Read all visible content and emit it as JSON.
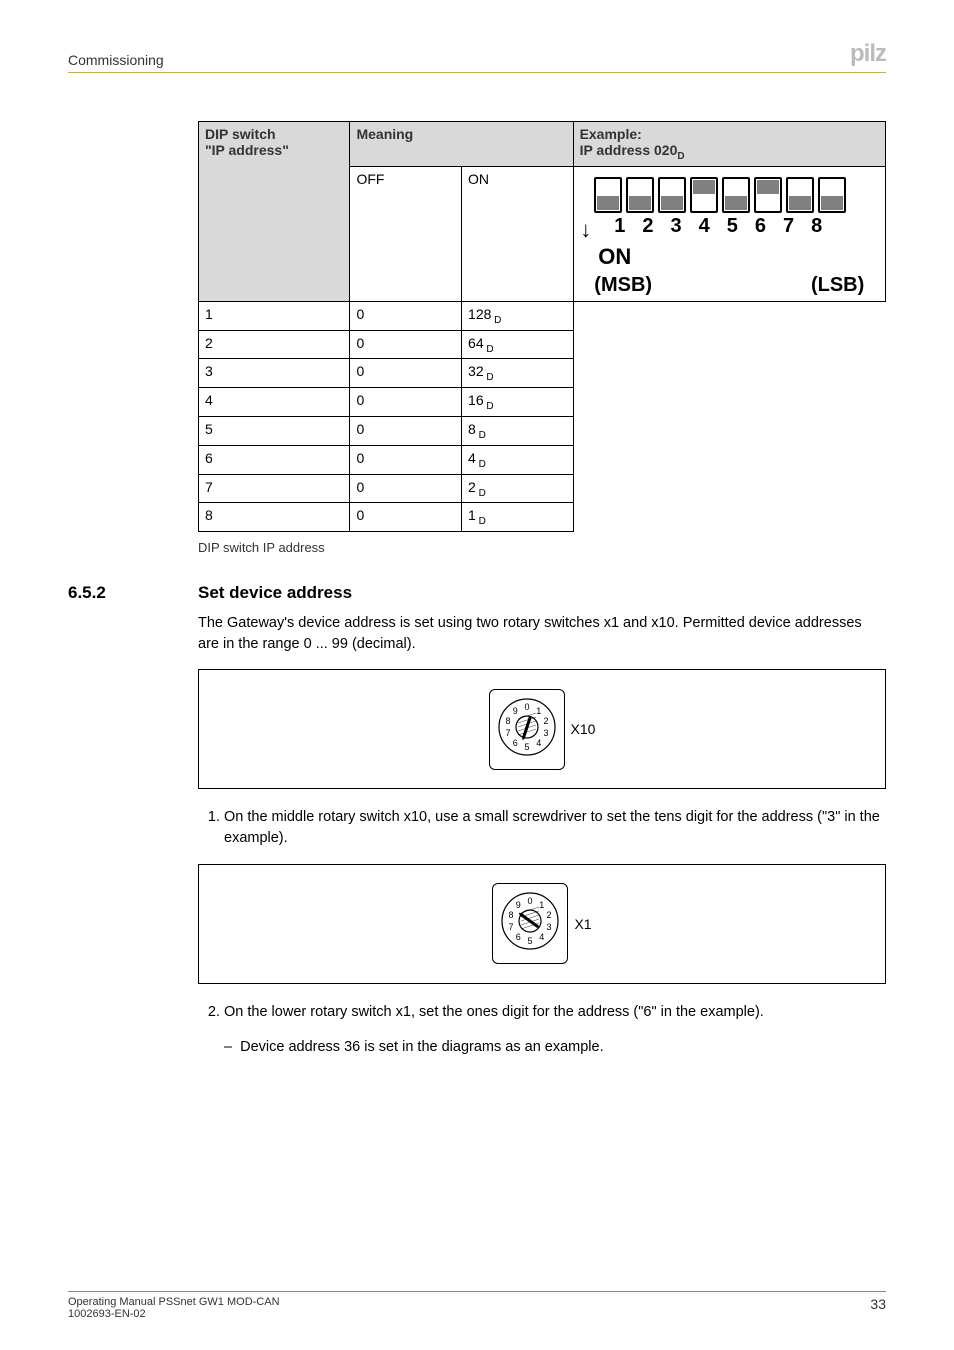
{
  "header": {
    "title": "Commissioning",
    "logo": "pilz"
  },
  "table": {
    "head": {
      "dip_switch": "DIP switch",
      "ip_address_label": "\"IP address\"",
      "meaning": "Meaning",
      "example": "Example:",
      "example_sub_prefix": "IP address 020",
      "example_sub_suffix": "D"
    },
    "meaning_cols": {
      "off": "OFF",
      "on": "ON"
    },
    "rows": [
      {
        "switch": "1",
        "off": "0",
        "on_val": "128",
        "on_sub": "D"
      },
      {
        "switch": "2",
        "off": "0",
        "on_val": "64",
        "on_sub": "D"
      },
      {
        "switch": "3",
        "off": "0",
        "on_val": "32",
        "on_sub": "D"
      },
      {
        "switch": "4",
        "off": "0",
        "on_val": "16",
        "on_sub": "D"
      },
      {
        "switch": "5",
        "off": "0",
        "on_val": "8",
        "on_sub": "D"
      },
      {
        "switch": "6",
        "off": "0",
        "on_val": "4",
        "on_sub": "D"
      },
      {
        "switch": "7",
        "off": "0",
        "on_val": "2",
        "on_sub": "D"
      },
      {
        "switch": "8",
        "off": "0",
        "on_val": "1",
        "on_sub": "D"
      }
    ],
    "caption": "DIP switch IP address",
    "graphic": {
      "numbers": "12345678",
      "on": "ON",
      "msb": "(MSB)",
      "lsb": "(LSB)",
      "positions": [
        "bottom",
        "bottom",
        "bottom",
        "top",
        "bottom",
        "top",
        "bottom",
        "bottom"
      ]
    }
  },
  "section": {
    "num": "6.5.2",
    "title": "Set device address",
    "intro": "The Gateway's device address is set using two rotary switches x1 and x10. Permitted device addresses are in the range 0 ... 99 (decimal).",
    "fig1_label": "X10",
    "step1": "On the middle rotary switch x10, use a small screwdriver to set the tens digit for the address (\"3\" in the example).",
    "fig2_label": "X1",
    "step2": "On the lower rotary switch x1, set the ones digit for the address (\"6\" in the example).",
    "sub_dash": "Device address 36 is set in the diagrams as an example."
  },
  "rotary": {
    "x10": {
      "digits": [
        "0",
        "1",
        "2",
        "3",
        "4",
        "5",
        "6",
        "7",
        "8",
        "9"
      ],
      "pointer_angle": 108
    },
    "x1": {
      "digits": [
        "0",
        "1",
        "2",
        "3",
        "4",
        "5",
        "6",
        "7",
        "8",
        "9"
      ],
      "pointer_angle": 216
    }
  },
  "footer": {
    "line1": "Operating Manual PSSnet GW1 MOD-CAN",
    "line2": "1002693-EN-02",
    "page": "33"
  }
}
